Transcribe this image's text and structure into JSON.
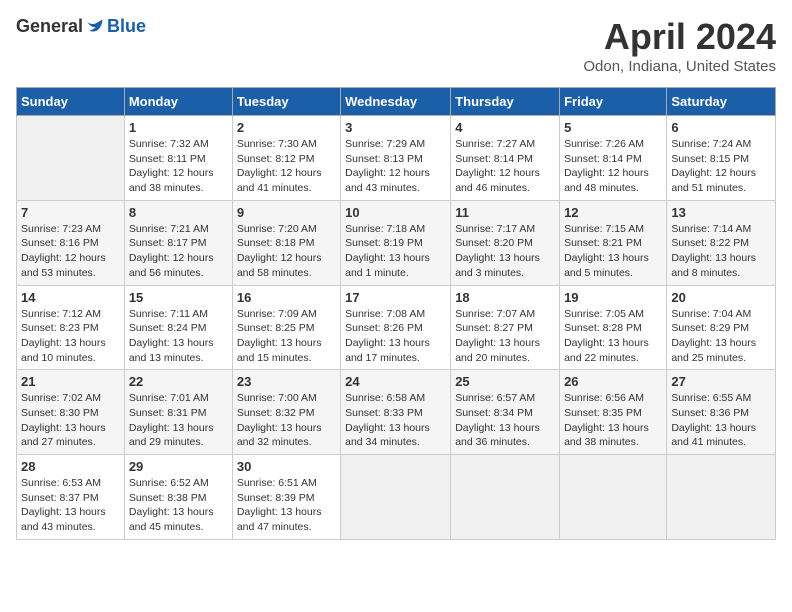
{
  "header": {
    "logo_general": "General",
    "logo_blue": "Blue",
    "month_title": "April 2024",
    "location": "Odon, Indiana, United States"
  },
  "columns": [
    "Sunday",
    "Monday",
    "Tuesday",
    "Wednesday",
    "Thursday",
    "Friday",
    "Saturday"
  ],
  "weeks": [
    [
      {
        "day": "",
        "sunrise": "",
        "sunset": "",
        "daylight": ""
      },
      {
        "day": "1",
        "sunrise": "Sunrise: 7:32 AM",
        "sunset": "Sunset: 8:11 PM",
        "daylight": "Daylight: 12 hours and 38 minutes."
      },
      {
        "day": "2",
        "sunrise": "Sunrise: 7:30 AM",
        "sunset": "Sunset: 8:12 PM",
        "daylight": "Daylight: 12 hours and 41 minutes."
      },
      {
        "day": "3",
        "sunrise": "Sunrise: 7:29 AM",
        "sunset": "Sunset: 8:13 PM",
        "daylight": "Daylight: 12 hours and 43 minutes."
      },
      {
        "day": "4",
        "sunrise": "Sunrise: 7:27 AM",
        "sunset": "Sunset: 8:14 PM",
        "daylight": "Daylight: 12 hours and 46 minutes."
      },
      {
        "day": "5",
        "sunrise": "Sunrise: 7:26 AM",
        "sunset": "Sunset: 8:14 PM",
        "daylight": "Daylight: 12 hours and 48 minutes."
      },
      {
        "day": "6",
        "sunrise": "Sunrise: 7:24 AM",
        "sunset": "Sunset: 8:15 PM",
        "daylight": "Daylight: 12 hours and 51 minutes."
      }
    ],
    [
      {
        "day": "7",
        "sunrise": "Sunrise: 7:23 AM",
        "sunset": "Sunset: 8:16 PM",
        "daylight": "Daylight: 12 hours and 53 minutes."
      },
      {
        "day": "8",
        "sunrise": "Sunrise: 7:21 AM",
        "sunset": "Sunset: 8:17 PM",
        "daylight": "Daylight: 12 hours and 56 minutes."
      },
      {
        "day": "9",
        "sunrise": "Sunrise: 7:20 AM",
        "sunset": "Sunset: 8:18 PM",
        "daylight": "Daylight: 12 hours and 58 minutes."
      },
      {
        "day": "10",
        "sunrise": "Sunrise: 7:18 AM",
        "sunset": "Sunset: 8:19 PM",
        "daylight": "Daylight: 13 hours and 1 minute."
      },
      {
        "day": "11",
        "sunrise": "Sunrise: 7:17 AM",
        "sunset": "Sunset: 8:20 PM",
        "daylight": "Daylight: 13 hours and 3 minutes."
      },
      {
        "day": "12",
        "sunrise": "Sunrise: 7:15 AM",
        "sunset": "Sunset: 8:21 PM",
        "daylight": "Daylight: 13 hours and 5 minutes."
      },
      {
        "day": "13",
        "sunrise": "Sunrise: 7:14 AM",
        "sunset": "Sunset: 8:22 PM",
        "daylight": "Daylight: 13 hours and 8 minutes."
      }
    ],
    [
      {
        "day": "14",
        "sunrise": "Sunrise: 7:12 AM",
        "sunset": "Sunset: 8:23 PM",
        "daylight": "Daylight: 13 hours and 10 minutes."
      },
      {
        "day": "15",
        "sunrise": "Sunrise: 7:11 AM",
        "sunset": "Sunset: 8:24 PM",
        "daylight": "Daylight: 13 hours and 13 minutes."
      },
      {
        "day": "16",
        "sunrise": "Sunrise: 7:09 AM",
        "sunset": "Sunset: 8:25 PM",
        "daylight": "Daylight: 13 hours and 15 minutes."
      },
      {
        "day": "17",
        "sunrise": "Sunrise: 7:08 AM",
        "sunset": "Sunset: 8:26 PM",
        "daylight": "Daylight: 13 hours and 17 minutes."
      },
      {
        "day": "18",
        "sunrise": "Sunrise: 7:07 AM",
        "sunset": "Sunset: 8:27 PM",
        "daylight": "Daylight: 13 hours and 20 minutes."
      },
      {
        "day": "19",
        "sunrise": "Sunrise: 7:05 AM",
        "sunset": "Sunset: 8:28 PM",
        "daylight": "Daylight: 13 hours and 22 minutes."
      },
      {
        "day": "20",
        "sunrise": "Sunrise: 7:04 AM",
        "sunset": "Sunset: 8:29 PM",
        "daylight": "Daylight: 13 hours and 25 minutes."
      }
    ],
    [
      {
        "day": "21",
        "sunrise": "Sunrise: 7:02 AM",
        "sunset": "Sunset: 8:30 PM",
        "daylight": "Daylight: 13 hours and 27 minutes."
      },
      {
        "day": "22",
        "sunrise": "Sunrise: 7:01 AM",
        "sunset": "Sunset: 8:31 PM",
        "daylight": "Daylight: 13 hours and 29 minutes."
      },
      {
        "day": "23",
        "sunrise": "Sunrise: 7:00 AM",
        "sunset": "Sunset: 8:32 PM",
        "daylight": "Daylight: 13 hours and 32 minutes."
      },
      {
        "day": "24",
        "sunrise": "Sunrise: 6:58 AM",
        "sunset": "Sunset: 8:33 PM",
        "daylight": "Daylight: 13 hours and 34 minutes."
      },
      {
        "day": "25",
        "sunrise": "Sunrise: 6:57 AM",
        "sunset": "Sunset: 8:34 PM",
        "daylight": "Daylight: 13 hours and 36 minutes."
      },
      {
        "day": "26",
        "sunrise": "Sunrise: 6:56 AM",
        "sunset": "Sunset: 8:35 PM",
        "daylight": "Daylight: 13 hours and 38 minutes."
      },
      {
        "day": "27",
        "sunrise": "Sunrise: 6:55 AM",
        "sunset": "Sunset: 8:36 PM",
        "daylight": "Daylight: 13 hours and 41 minutes."
      }
    ],
    [
      {
        "day": "28",
        "sunrise": "Sunrise: 6:53 AM",
        "sunset": "Sunset: 8:37 PM",
        "daylight": "Daylight: 13 hours and 43 minutes."
      },
      {
        "day": "29",
        "sunrise": "Sunrise: 6:52 AM",
        "sunset": "Sunset: 8:38 PM",
        "daylight": "Daylight: 13 hours and 45 minutes."
      },
      {
        "day": "30",
        "sunrise": "Sunrise: 6:51 AM",
        "sunset": "Sunset: 8:39 PM",
        "daylight": "Daylight: 13 hours and 47 minutes."
      },
      {
        "day": "",
        "sunrise": "",
        "sunset": "",
        "daylight": ""
      },
      {
        "day": "",
        "sunrise": "",
        "sunset": "",
        "daylight": ""
      },
      {
        "day": "",
        "sunrise": "",
        "sunset": "",
        "daylight": ""
      },
      {
        "day": "",
        "sunrise": "",
        "sunset": "",
        "daylight": ""
      }
    ]
  ]
}
